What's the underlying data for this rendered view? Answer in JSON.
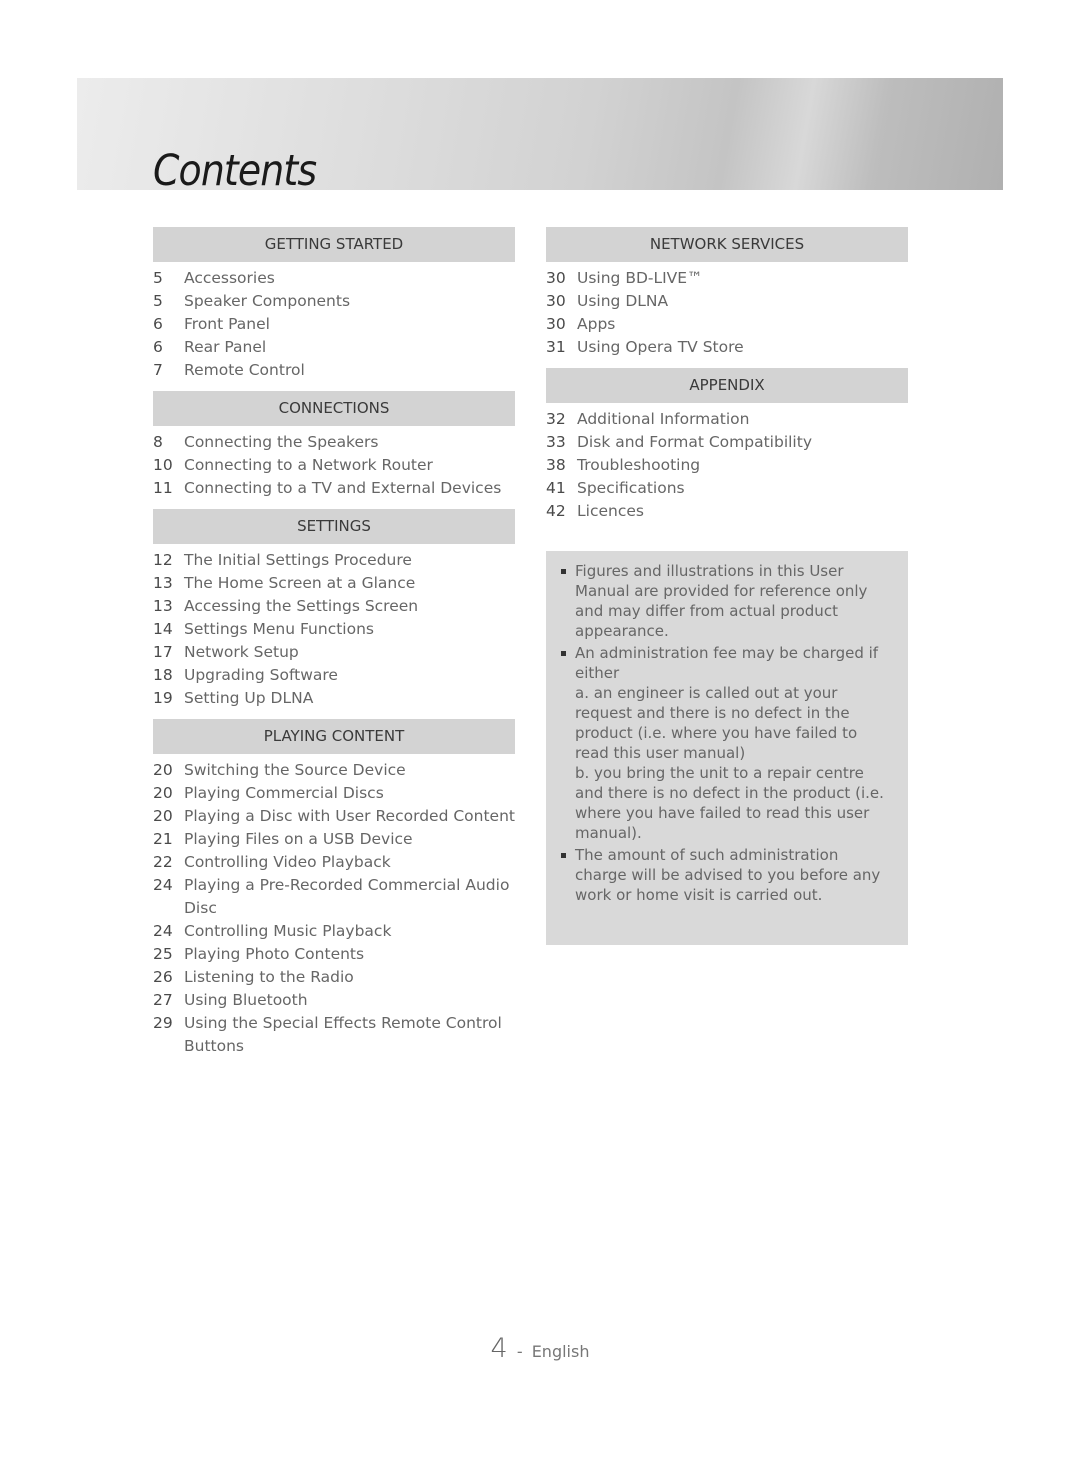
{
  "banner": {
    "title": "Contents"
  },
  "left_column": [
    {
      "header": "GETTING STARTED",
      "entries": [
        {
          "page": "5",
          "title": "Accessories"
        },
        {
          "page": "5",
          "title": "Speaker Components"
        },
        {
          "page": "6",
          "title": "Front Panel"
        },
        {
          "page": "6",
          "title": "Rear Panel"
        },
        {
          "page": "7",
          "title": "Remote Control"
        }
      ]
    },
    {
      "header": "CONNECTIONS",
      "entries": [
        {
          "page": "8",
          "title": "Connecting the Speakers"
        },
        {
          "page": "10",
          "title": "Connecting to a Network Router"
        },
        {
          "page": "11",
          "title": "Connecting to a TV and External Devices"
        }
      ]
    },
    {
      "header": "SETTINGS",
      "entries": [
        {
          "page": "12",
          "title": "The Initial Settings Procedure"
        },
        {
          "page": "13",
          "title": "The Home Screen at a Glance"
        },
        {
          "page": "13",
          "title": "Accessing the Settings Screen"
        },
        {
          "page": "14",
          "title": "Settings Menu Functions"
        },
        {
          "page": "17",
          "title": "Network Setup"
        },
        {
          "page": "18",
          "title": "Upgrading Software"
        },
        {
          "page": "19",
          "title": "Setting Up DLNA"
        }
      ]
    },
    {
      "header": "PLAYING CONTENT",
      "entries": [
        {
          "page": "20",
          "title": "Switching the Source Device"
        },
        {
          "page": "20",
          "title": "Playing Commercial Discs"
        },
        {
          "page": "20",
          "title": "Playing a Disc with User Recorded Content"
        },
        {
          "page": "21",
          "title": "Playing Files on a USB Device"
        },
        {
          "page": "22",
          "title": "Controlling Video Playback"
        },
        {
          "page": "24",
          "title": "Playing a Pre-Recorded Commercial Audio Disc"
        },
        {
          "page": "24",
          "title": "Controlling Music Playback"
        },
        {
          "page": "25",
          "title": "Playing Photo Contents"
        },
        {
          "page": "26",
          "title": "Listening to the Radio"
        },
        {
          "page": "27",
          "title": "Using Bluetooth"
        },
        {
          "page": "29",
          "title": "Using the Special Effects Remote Control Buttons"
        }
      ]
    }
  ],
  "right_column": [
    {
      "header": "NETWORK SERVICES",
      "entries": [
        {
          "page": "30",
          "title": "Using BD-LIVE™"
        },
        {
          "page": "30",
          "title": "Using DLNA"
        },
        {
          "page": "30",
          "title": "Apps"
        },
        {
          "page": "31",
          "title": "Using Opera TV Store"
        }
      ]
    },
    {
      "header": "APPENDIX",
      "entries": [
        {
          "page": "32",
          "title": "Additional Information"
        },
        {
          "page": "33",
          "title": "Disk and Format Compatibility"
        },
        {
          "page": "38",
          "title": "Troubleshooting"
        },
        {
          "page": "41",
          "title": "Specifications"
        },
        {
          "page": "42",
          "title": "Licences"
        }
      ]
    }
  ],
  "notes": [
    "Figures and illustrations in this User Manual are provided for reference only and may differ from actual product appearance.",
    "An administration fee may be charged if either\na. an engineer is called out at your request and there is no defect in the product (i.e. where you have failed to read this user manual)\nb. you bring the unit to a repair centre and there is no defect in the product (i.e. where you have failed to read this user manual).",
    "The amount of such administration charge will be advised to you before any work or home visit is carried out."
  ],
  "footer": {
    "page_number": "4",
    "separator": "-",
    "language": "English"
  }
}
